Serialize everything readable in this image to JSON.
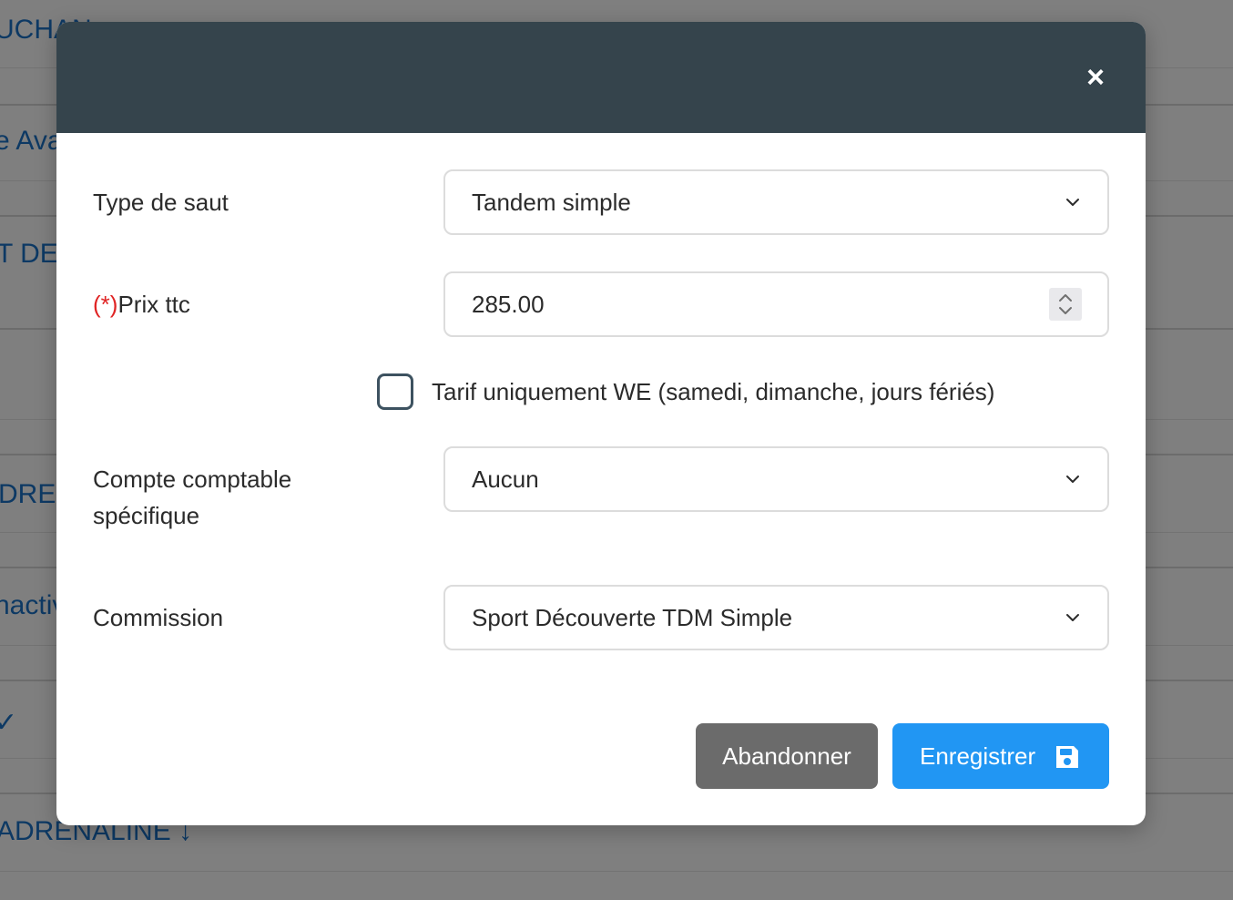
{
  "background": {
    "fragments": [
      "UCHAN",
      "e Avar",
      "T DEC",
      "DREN",
      "nactiv",
      "✓",
      "ADRENALINE ↓"
    ]
  },
  "modal": {
    "close_label": "×",
    "fields": {
      "type_de_saut": {
        "label": "Type de saut",
        "value": "Tandem simple"
      },
      "prix": {
        "required_mark": "(*)",
        "label": "Prix ttc",
        "value": "285.00"
      },
      "compte": {
        "label_line1": "Compte comptable",
        "label_line2": "spécifique",
        "value": "Aucun"
      },
      "commission": {
        "label": "Commission",
        "value": "Sport Découverte TDM Simple"
      }
    },
    "checkbox": {
      "label": "Tarif uniquement WE (samedi, dimanche, jours fériés)",
      "checked": false
    },
    "buttons": {
      "cancel": "Abandonner",
      "save": "Enregistrer"
    },
    "colors": {
      "header": "#35444c",
      "primary": "#2196f3",
      "secondary": "#6b6b6b",
      "required": "#e02424",
      "link": "#1a73c8"
    }
  }
}
